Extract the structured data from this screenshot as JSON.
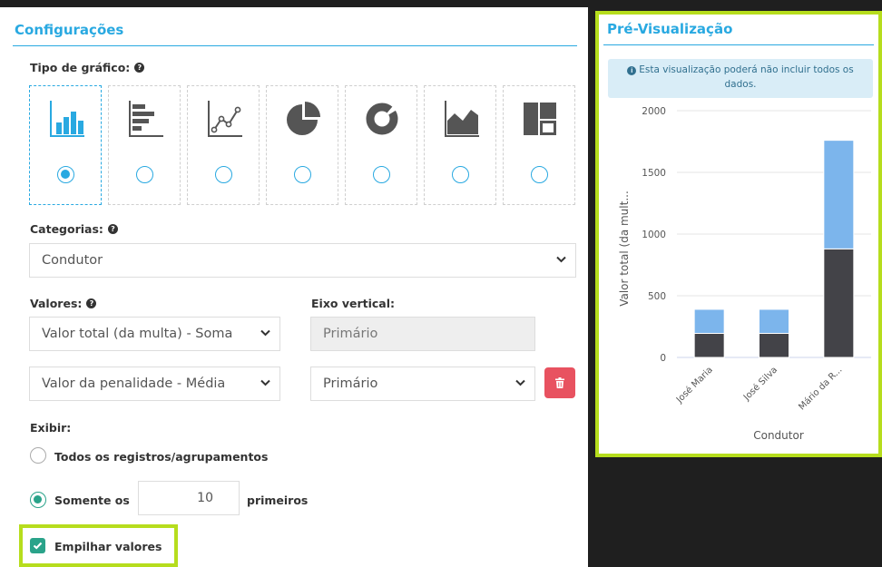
{
  "config": {
    "title": "Configurações",
    "chart_type_label": "Tipo de gráfico:",
    "chart_types": [
      {
        "icon": "bar-chart-icon",
        "selected": true
      },
      {
        "icon": "horizontal-bar-chart-icon",
        "selected": false
      },
      {
        "icon": "line-chart-icon",
        "selected": false
      },
      {
        "icon": "pie-chart-icon",
        "selected": false
      },
      {
        "icon": "donut-chart-icon",
        "selected": false
      },
      {
        "icon": "area-chart-icon",
        "selected": false
      },
      {
        "icon": "treemap-chart-icon",
        "selected": false
      }
    ],
    "categories_label": "Categorias:",
    "categories_value": "Condutor",
    "values_label": "Valores:",
    "axis_label": "Eixo vertical:",
    "value_rows": [
      {
        "value": "Valor total (da multa) - Soma",
        "axis": "Primário",
        "axis_disabled": true
      },
      {
        "value": "Valor da penalidade - Média",
        "axis": "Primário",
        "axis_disabled": false
      }
    ],
    "exibir_label": "Exibir:",
    "option_all": "Todos os registros/agrupamentos",
    "option_only_prefix": "Somente os",
    "option_only_count": "10",
    "option_only_suffix": "primeiros",
    "stack_label": "Empilhar valores",
    "stack_checked": true
  },
  "preview": {
    "title": "Pré-Visualização",
    "notice": "Esta visualização poderá não incluir todos os dados."
  },
  "colors": {
    "accent": "#29a9e1",
    "highlight": "#b6dd1d",
    "series_dark": "#434348",
    "series_light": "#7cb5ec",
    "danger": "#e85260",
    "check": "#2aa38a"
  },
  "chart_data": {
    "type": "bar",
    "stacked": true,
    "categories": [
      "José Maria",
      "José Silva",
      "Mário da R..."
    ],
    "series": [
      {
        "values": [
          195,
          195,
          880
        ],
        "color": "#434348"
      },
      {
        "values": [
          195,
          195,
          880
        ],
        "color": "#7cb5ec"
      }
    ],
    "xlabel": "Condutor",
    "ylabel": "Valor total (da mult...",
    "ylim": [
      0,
      2000
    ],
    "yticks": [
      0,
      500,
      1000,
      1500,
      2000
    ],
    "grid": true,
    "legend": "none"
  }
}
